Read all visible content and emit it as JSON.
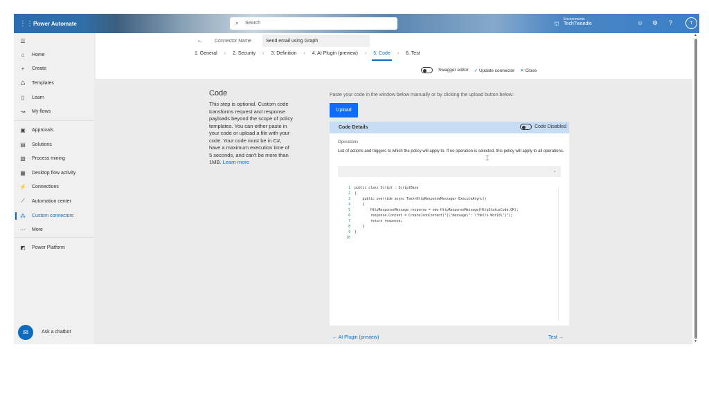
{
  "topbar": {
    "app_name": "Power Automate",
    "search_placeholder": "Search",
    "env_label": "Environments",
    "env_name": "TechTweedie",
    "avatar": "T"
  },
  "sidebar": {
    "items": [
      {
        "label": "Home",
        "icon": "home-icon"
      },
      {
        "label": "Create",
        "icon": "plus-icon"
      },
      {
        "label": "Templates",
        "icon": "templates-icon"
      },
      {
        "label": "Learn",
        "icon": "book-icon"
      },
      {
        "label": "My flows",
        "icon": "flow-icon"
      },
      {
        "label": "Approvals",
        "icon": "approvals-icon"
      },
      {
        "label": "Solutions",
        "icon": "solutions-icon"
      },
      {
        "label": "Process mining",
        "icon": "process-mining-icon"
      },
      {
        "label": "Desktop flow activity",
        "icon": "desktop-flow-icon"
      },
      {
        "label": "Connections",
        "icon": "connections-icon"
      },
      {
        "label": "Automation center",
        "icon": "chart-icon"
      },
      {
        "label": "Custom connectors",
        "icon": "custom-connectors-icon"
      },
      {
        "label": "More",
        "icon": "more-icon"
      },
      {
        "label": "Power Platform",
        "icon": "power-platform-icon"
      }
    ],
    "chatbot": "Ask a chatbot"
  },
  "header": {
    "connector_name_label": "Connector Name",
    "connector_name": "Send email using Graph",
    "steps": [
      "1. General",
      "2. Security",
      "3. Definition",
      "4. AI Plugin (preview)",
      "5. Code",
      "6. Test"
    ],
    "active_step": 4,
    "swagger": "Swagger editor",
    "update": "Update connector",
    "close": "Close"
  },
  "content": {
    "title": "Code",
    "description": "This step is optional. Custom code transforms request and response payloads beyond the scope of policy templates. You can either paste in your code or upload a file with your code. Your code must be in C#, have a maximum execution time of 5 seconds, and can't be more than 1MB.",
    "learn_more": "Learn more",
    "paste_hint": "Paste your code in the window below manually or by clicking the upload button below:",
    "upload": "Upload",
    "panel_title": "Code Details",
    "code_toggle": "Code Disabled",
    "operations_label": "Operations",
    "operations_desc": "List of actions and triggers to which the policy will apply to. If no operation is selected, this policy will apply to all operations.",
    "code_lines": [
      "public class Script : ScriptBase",
      "{",
      "    public override async Task<HttpResponseMessage> ExecuteAsync()",
      "    {",
      "        HttpResponseMessage response = new HttpResponseMessage(HttpStatusCode.OK);",
      "        response.Content = CreateJsonContent(\"{\\\"message\\\": \\\"Hello World\\\"}\");",
      "        return response;",
      "    }",
      "}",
      ""
    ],
    "prev": "AI Plugin (preview)",
    "next": "Test"
  }
}
